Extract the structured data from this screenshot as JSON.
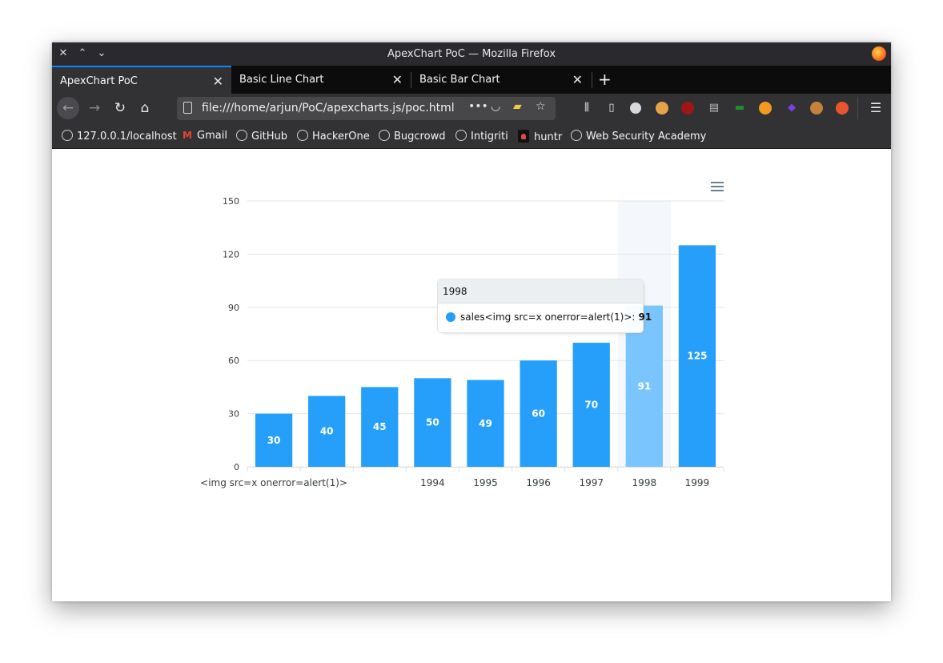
{
  "window": {
    "title": "ApexChart PoC — Mozilla Firefox"
  },
  "window_controls": {
    "close": "✕",
    "maximize": "⌃",
    "minimize": "⌄"
  },
  "tabs": [
    {
      "label": "ApexChart PoC",
      "active": true
    },
    {
      "label": "Basic Line Chart",
      "active": false
    },
    {
      "label": "Basic Bar Chart",
      "active": false
    }
  ],
  "nav": {
    "url": "file:///home/arjun/PoC/apexcharts.js/poc.html"
  },
  "bookmarks": [
    "127.0.0.1/localhost",
    "Gmail",
    "GitHub",
    "HackerOne",
    "Bugcrowd",
    "Intigriti",
    "huntr",
    "Web Security Academy"
  ],
  "colors": {
    "bar": "#269ffb",
    "bar_hover": "#7ac5fd",
    "accent": "#0a84ff"
  },
  "tooltip": {
    "title": "1998",
    "series_label": "sales<img src=x onerror=alert(1)>:",
    "value": "91"
  },
  "chart_data": {
    "type": "bar",
    "categories": [
      "<img src=x onerror=alert(1)>",
      "",
      "",
      "1994",
      "1995",
      "1996",
      "1997",
      "1998",
      "1999"
    ],
    "series": [
      {
        "name": "sales<img src=x onerror=alert(1)>",
        "values": [
          30,
          40,
          45,
          50,
          49,
          60,
          70,
          91,
          125
        ]
      }
    ],
    "y_ticks": [
      "0",
      "30",
      "60",
      "90",
      "120",
      "150"
    ],
    "ylim": [
      0,
      150
    ],
    "data_labels": true,
    "grid": true,
    "hovered_category": "1998"
  }
}
